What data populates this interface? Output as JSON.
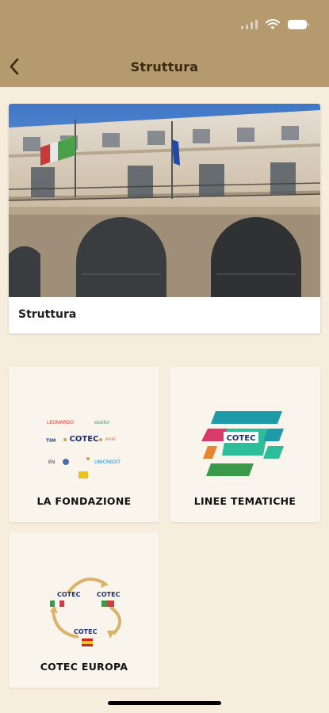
{
  "header": {
    "title": "Struttura",
    "back_icon": "chevron-left-icon"
  },
  "status_bar": {
    "icons": [
      "signal-icon",
      "wifi-icon",
      "battery-icon"
    ]
  },
  "hero": {
    "caption": "Struttura",
    "image": "building-facade-photo"
  },
  "tiles": [
    {
      "label": "LA FONDAZIONE",
      "logo": "partners-logo-cluster",
      "logo_text": "COTEC"
    },
    {
      "label": "LINEE TEMATICHE",
      "logo": "cotec-themes-logo",
      "logo_text": "COTEC"
    },
    {
      "label": "COTEC EUROPA",
      "logo": "cotec-europe-logo",
      "logo_text": "COTEC"
    }
  ],
  "colors": {
    "header_bg": "#b59a6e",
    "page_bg": "#f7eddd",
    "tile_bg": "#faf5ec",
    "title_text": "#3a2a14"
  }
}
